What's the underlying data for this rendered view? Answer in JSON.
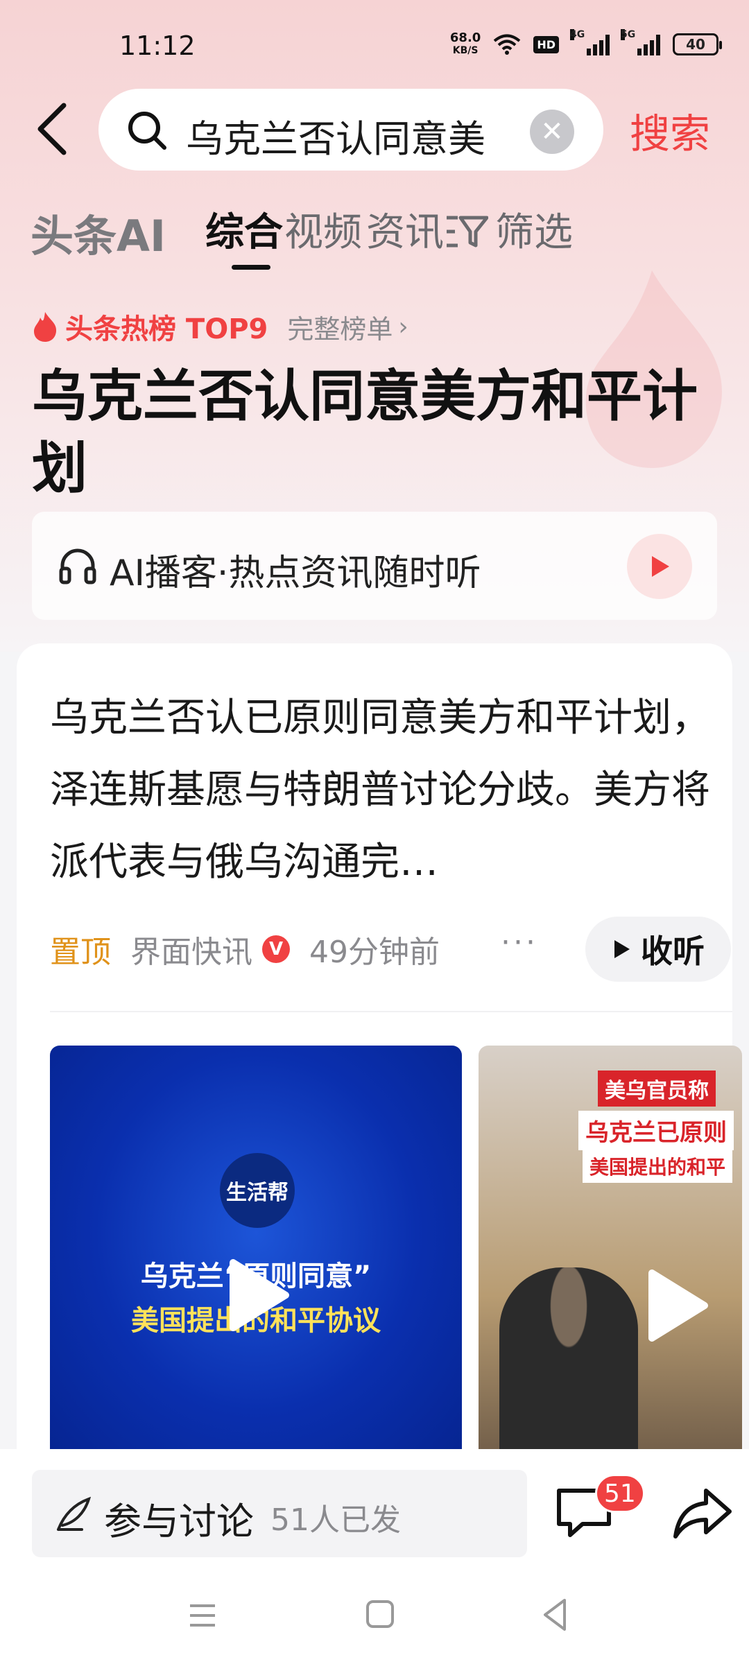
{
  "status_bar": {
    "time": "11:12",
    "net_speed_value": "68.0",
    "net_speed_unit": "KB/S",
    "hd_label": "HD",
    "signal1_label": "4G",
    "signal2_label": "5G",
    "battery": "40"
  },
  "search": {
    "query": "乌克兰否认同意美",
    "submit_label": "搜索"
  },
  "tabs": {
    "ai_label": "头条AI",
    "items": [
      "综合",
      "视频",
      "资讯"
    ],
    "filter_label": "筛选",
    "active": "综合"
  },
  "hot": {
    "tag": "头条热榜 TOP9",
    "full_list": "完整榜单"
  },
  "topic_title": "乌克兰否认同意美方和平计划",
  "podcast": {
    "text": "AI播客·热点资讯随时听"
  },
  "article": {
    "title": "乌克兰否认已原则同意美方和平计划，泽连斯基愿与特朗普讨论分歧。美方将派代表与俄乌沟通完…",
    "pin_label": "置顶",
    "source": "界面快讯",
    "verified_badge": "V",
    "time": "49分钟前",
    "more": "···",
    "listen_label": "收听"
  },
  "video1": {
    "logo_text": "生活帮",
    "line1": "乌克兰“原则同意”",
    "line2": "美国提出的和平协议"
  },
  "video2": {
    "cap1": "美乌官员称",
    "cap2": "乌克兰已原则",
    "cap3": "美国提出的和平"
  },
  "bottom": {
    "discuss_label": "参与讨论",
    "discuss_count": "51人已发",
    "comment_count": "51"
  },
  "colors": {
    "accent": "#f04142",
    "pin": "#e0921a"
  }
}
